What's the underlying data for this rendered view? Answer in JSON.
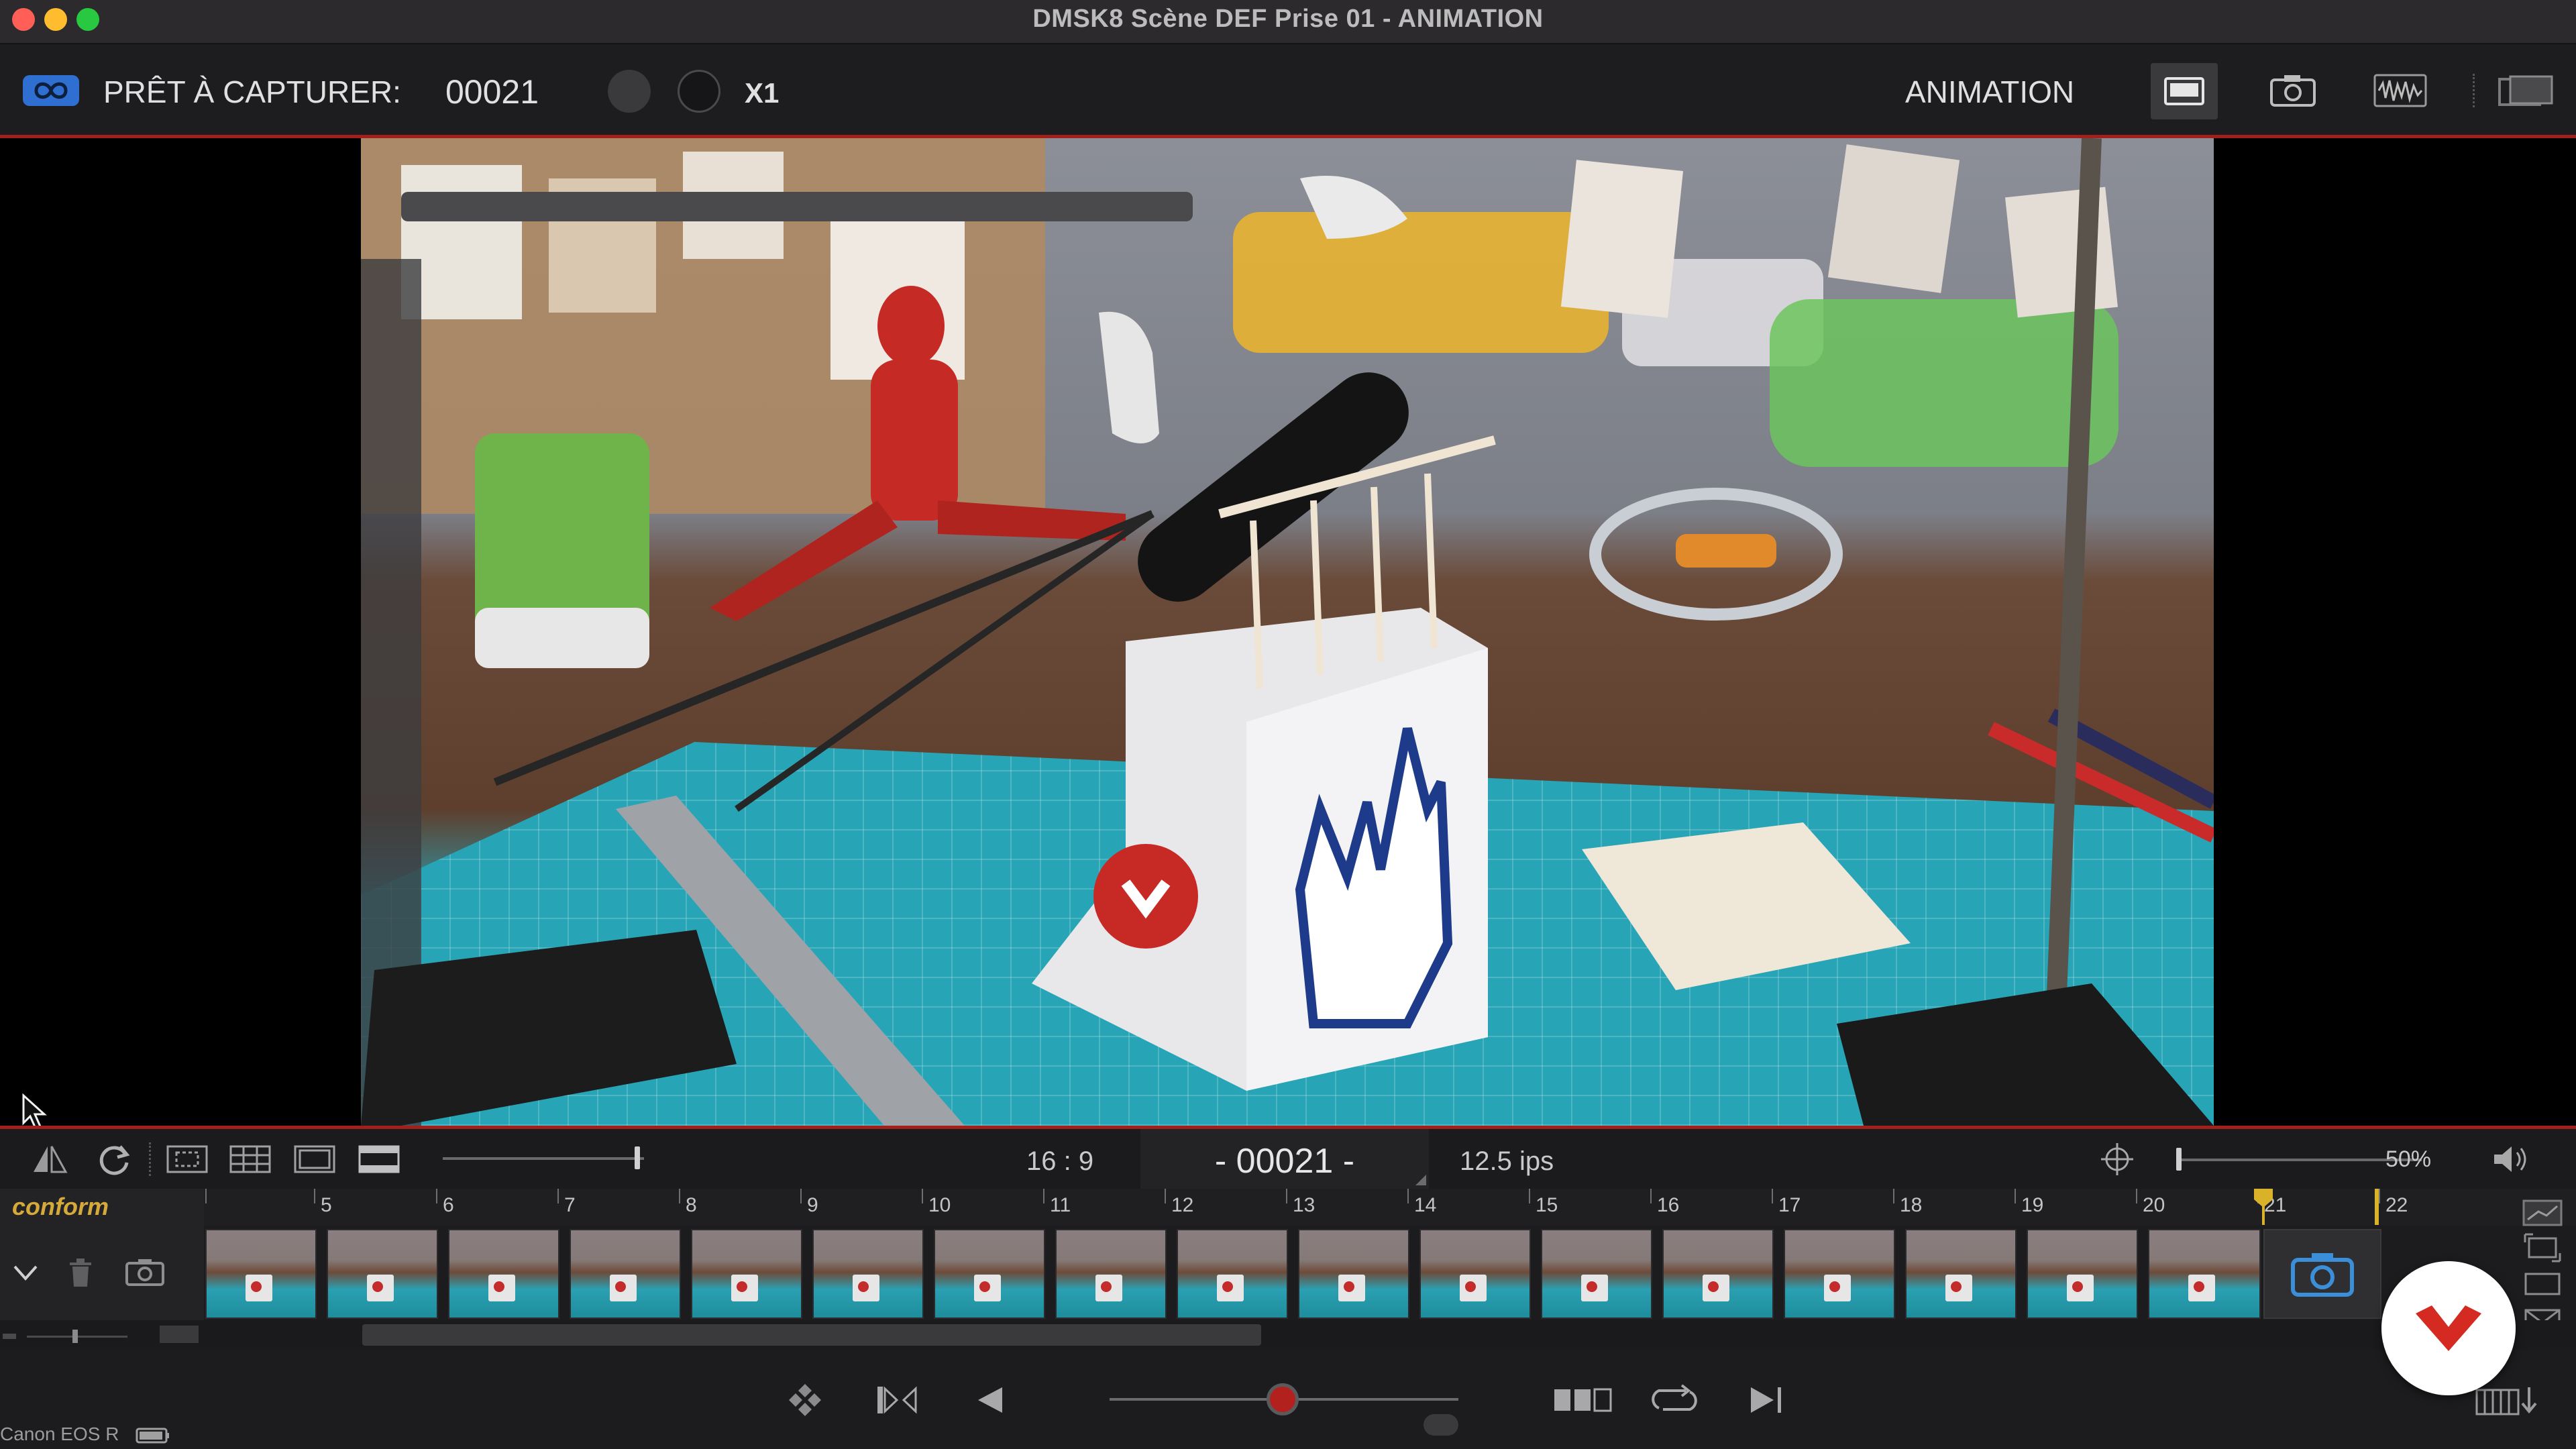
{
  "window": {
    "title": "DMSK8  Scène DEF  Prise 01 - ANIMATION"
  },
  "toolbar": {
    "ready_label": "PRÊT À CAPTURER:",
    "frame_counter": "00021",
    "multiplier": "X1",
    "mode_label": "ANIMATION",
    "icons": [
      "infinity-loop-icon",
      "monitor-icon",
      "camera-icon",
      "audio-waveform-icon",
      "display-compare-icon"
    ]
  },
  "timeline_toolbar": {
    "aspect_ratio": "16 : 9",
    "current_frame": "- 00021 -",
    "fps": "12.5 ips",
    "zoom": "50%",
    "icons": [
      "flip-icon",
      "refresh-icon",
      "safe-area-icon",
      "grid-icon",
      "frame-icon",
      "letterbox-icon",
      "crosshair-icon",
      "volume-icon"
    ]
  },
  "timeline": {
    "layer_name": "conform",
    "tick_labels": [
      "5",
      "6",
      "7",
      "8",
      "9",
      "10",
      "11",
      "12",
      "13",
      "14",
      "15",
      "16",
      "17",
      "18",
      "19",
      "20",
      "21",
      "22"
    ],
    "thumbnail_count": 17
  },
  "status": {
    "camera": "Canon EOS R"
  },
  "colors": {
    "accent_red": "#a31f1c",
    "camera_blue": "#3b8fd8",
    "playhead_yellow": "#d9b22a",
    "layer_label": "#d6a93b",
    "brand_red": "#d42a22"
  }
}
